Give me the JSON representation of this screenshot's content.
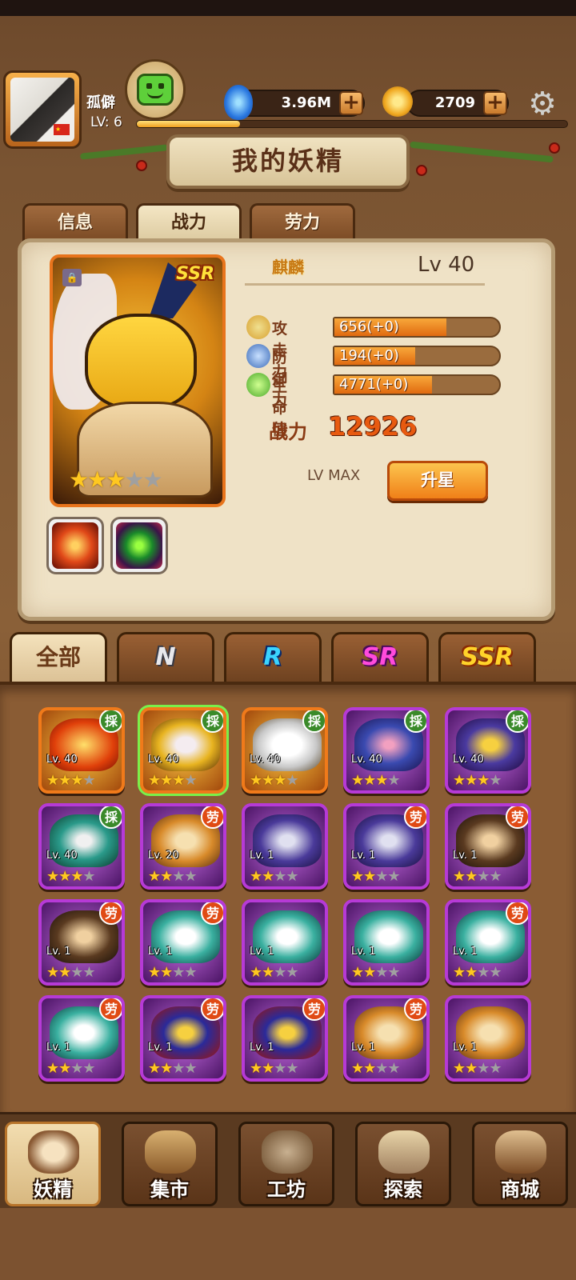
{
  "player": {
    "name": "孤僻",
    "level": "LV: 6",
    "xp_fraction": 0.24
  },
  "currency": {
    "gems": "3.96M",
    "coins": "2709"
  },
  "icons": {
    "chat": "chat-smile-icon",
    "gems": "blue-flame-icon",
    "coins": "moon-coin-icon",
    "settings": "gear-icon",
    "add": "plus-icon",
    "lock": "lock-icon"
  },
  "title": "我的妖精",
  "detail_tabs": [
    "信息",
    "战力",
    "劳力"
  ],
  "active_detail_tab": "战力",
  "hero": {
    "name": "麒麟",
    "level": "Lv 40",
    "rarity": "SSR",
    "stars": 3,
    "max_stars": 5,
    "stats": [
      {
        "label": "攻击力",
        "value": "656(+0)",
        "fill": 0.68
      },
      {
        "label": "防御力",
        "value": "194(+0)",
        "fill": 0.49
      },
      {
        "label": "生命值",
        "value": "4771(+0)",
        "fill": 0.59
      }
    ],
    "power_label": "战力",
    "power_value": "12926",
    "max_label": "LV MAX",
    "upgrade_label": "升星"
  },
  "rarity_tabs": [
    "全部",
    "N",
    "R",
    "SR",
    "SSR"
  ],
  "active_rarity_tab": "全部",
  "roster": [
    {
      "level": "Lv. 40",
      "badge": "採",
      "stars": 3,
      "rarity": "SSR",
      "art": "fire"
    },
    {
      "level": "Lv. 40",
      "badge": "採",
      "stars": 3,
      "rarity": "SSR",
      "art": "gold",
      "selected": true
    },
    {
      "level": "Lv. 40",
      "badge": "採",
      "stars": 3,
      "rarity": "SSR",
      "art": "white"
    },
    {
      "level": "Lv. 40",
      "badge": "採",
      "stars": 3,
      "rarity": "SR",
      "art": "blue"
    },
    {
      "level": "Lv. 40",
      "badge": "採",
      "stars": 3,
      "rarity": "SR",
      "art": "eagle"
    },
    {
      "level": "Lv. 40",
      "badge": "採",
      "stars": 3,
      "rarity": "SR",
      "art": "teal"
    },
    {
      "level": "Lv. 20",
      "badge": "劳",
      "stars": 2,
      "rarity": "SR",
      "art": "tiger"
    },
    {
      "level": "Lv. 1",
      "badge": "",
      "stars": 2,
      "rarity": "SR",
      "art": "purple"
    },
    {
      "level": "Lv. 1",
      "badge": "劳",
      "stars": 2,
      "rarity": "SR",
      "art": "purple"
    },
    {
      "level": "Lv. 1",
      "badge": "劳",
      "stars": 2,
      "rarity": "SR",
      "art": "boar"
    },
    {
      "level": "Lv. 1",
      "badge": "劳",
      "stars": 2,
      "rarity": "SR",
      "art": "boar"
    },
    {
      "level": "Lv. 1",
      "badge": "劳",
      "stars": 2,
      "rarity": "SR",
      "art": "wolf"
    },
    {
      "level": "Lv. 1",
      "badge": "",
      "stars": 2,
      "rarity": "SR",
      "art": "wolf"
    },
    {
      "level": "Lv. 1",
      "badge": "",
      "stars": 2,
      "rarity": "SR",
      "art": "wolf"
    },
    {
      "level": "Lv. 1",
      "badge": "劳",
      "stars": 2,
      "rarity": "SR",
      "art": "wolf"
    },
    {
      "level": "Lv. 1",
      "badge": "劳",
      "stars": 2,
      "rarity": "SR",
      "art": "wolf"
    },
    {
      "level": "Lv. 1",
      "badge": "劳",
      "stars": 2,
      "rarity": "SR",
      "art": "hawk"
    },
    {
      "level": "Lv. 1",
      "badge": "劳",
      "stars": 2,
      "rarity": "SR",
      "art": "hawk"
    },
    {
      "level": "Lv. 1",
      "badge": "劳",
      "stars": 2,
      "rarity": "SR",
      "art": "tiger"
    },
    {
      "level": "Lv. 1",
      "badge": "",
      "stars": 2,
      "rarity": "SR",
      "art": "tiger"
    }
  ],
  "bottom_nav": [
    "妖精",
    "集市",
    "工坊",
    "探索",
    "商城"
  ],
  "active_nav": "妖精"
}
